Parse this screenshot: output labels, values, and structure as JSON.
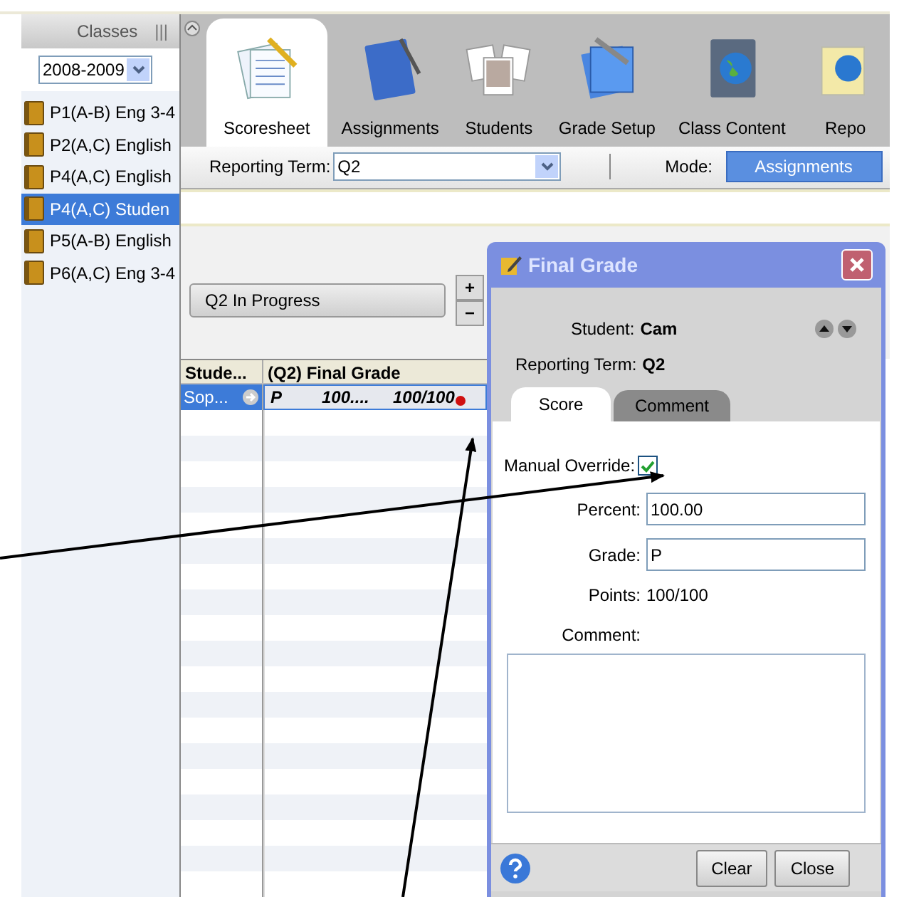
{
  "sidebar": {
    "title": "Classes",
    "grip": "|||",
    "year": "2008-2009",
    "items": [
      {
        "label": "P1(A-B) Eng 3-4",
        "selected": false
      },
      {
        "label": "P2(A,C) English",
        "selected": false
      },
      {
        "label": "P4(A,C) English",
        "selected": false
      },
      {
        "label": "P4(A,C) Studen",
        "selected": true
      },
      {
        "label": "P5(A-B) English",
        "selected": false
      },
      {
        "label": "P6(A,C) Eng 3-4",
        "selected": false
      }
    ]
  },
  "toolbar": {
    "tabs": [
      {
        "label": "Scoresheet",
        "kind": "scoresheet",
        "selected": true
      },
      {
        "label": "Assignments",
        "kind": "notebook",
        "selected": false
      },
      {
        "label": "Students",
        "kind": "photos",
        "selected": false
      },
      {
        "label": "Grade Setup",
        "kind": "setup",
        "selected": false
      },
      {
        "label": "Class Content",
        "kind": "globe",
        "selected": false
      },
      {
        "label": "Repo",
        "kind": "report",
        "selected": false
      }
    ]
  },
  "filter_bar": {
    "term_label": "Reporting Term:",
    "term": "Q2",
    "mode_label": "Mode:",
    "mode": "Assignments"
  },
  "progress_button": "Q2 In Progress",
  "zoom_in": "+",
  "zoom_out": "−",
  "grid": {
    "columns": [
      "Stude...",
      "(Q2) Final Grade"
    ],
    "rows": [
      {
        "student": "Sop...",
        "grade": "P",
        "percent": "100....",
        "points": "100/100",
        "selected": true
      }
    ]
  },
  "dialog": {
    "title": "Final Grade",
    "student_label": "Student:",
    "student": "Cam",
    "term_label": "Reporting Term:",
    "term": "Q2",
    "tabs": [
      {
        "label": "Score",
        "selected": true
      },
      {
        "label": "Comment",
        "selected": false
      }
    ],
    "override_label": "Manual Override:",
    "override_checked": true,
    "percent_label": "Percent:",
    "percent": "100.00",
    "grade_label": "Grade:",
    "grade": "P",
    "points_label": "Points:",
    "points": "100/100",
    "comment_label": "Comment:",
    "buttons": [
      "Clear",
      "Close"
    ]
  }
}
